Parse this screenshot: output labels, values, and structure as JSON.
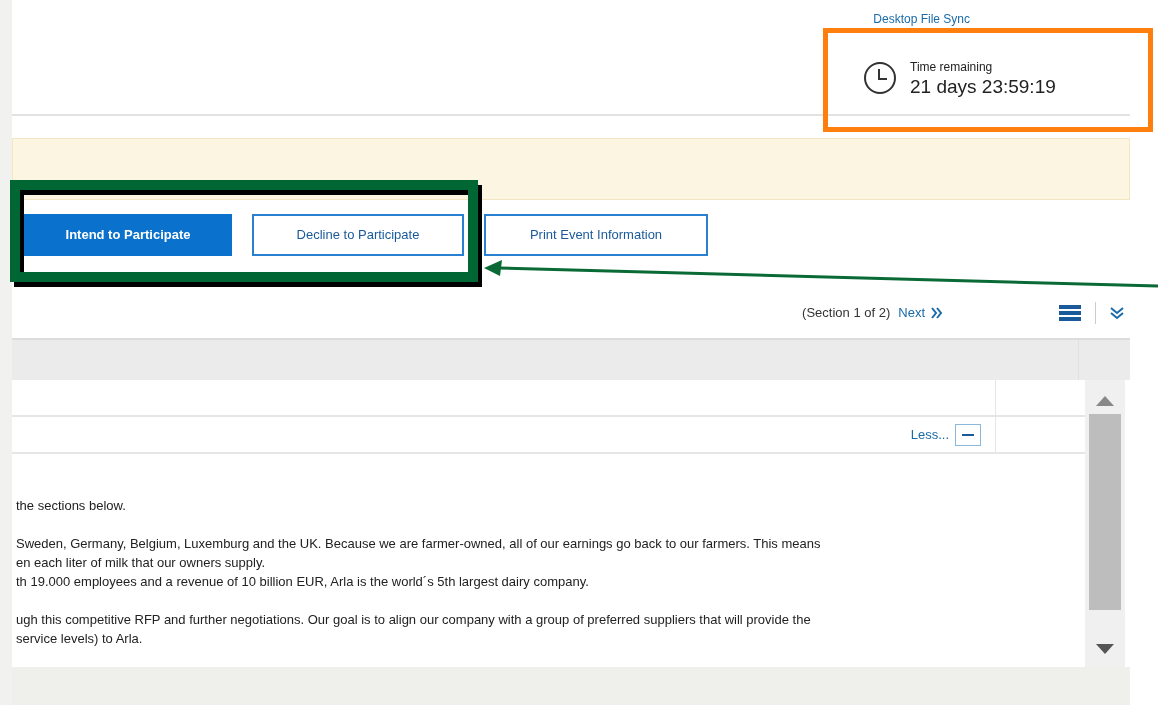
{
  "header": {
    "link": "Desktop File Sync",
    "time_label": "Time remaining",
    "time_value": "21 days 23:59:19"
  },
  "actions": [
    {
      "label": "Intend to Participate",
      "kind": "primary"
    },
    {
      "label": "Decline to Participate",
      "kind": "secondary"
    },
    {
      "label": "Print Event Information",
      "kind": "secondary"
    }
  ],
  "pager": {
    "section": "(Section 1 of 2)",
    "next": "Next"
  },
  "row_toggle": {
    "label": "Less...",
    "expanded": true
  },
  "body_paragraphs": [
    [
      "the sections below."
    ],
    [
      "Sweden, Germany, Belgium, Luxemburg and the UK. Because we are farmer-owned, all of our earnings go back to our farmers. This means",
      "en each liter of milk that our owners supply.",
      "th 19.000 employees and a revenue of 10 billion EUR, Arla is the world´s 5th largest dairy company."
    ],
    [
      "ugh this competitive RFP and further negotiations. Our goal is to align our company with a group of preferred suppliers that will provide the",
      "service levels) to Arla."
    ]
  ]
}
